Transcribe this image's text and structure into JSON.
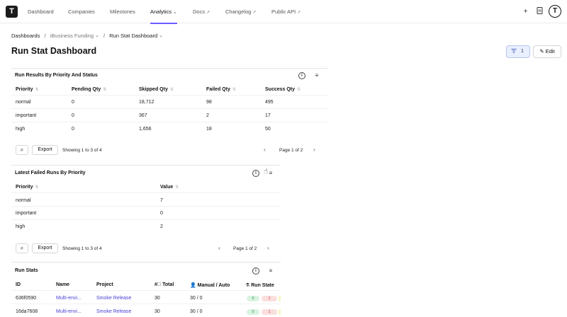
{
  "app": {
    "logo_letter": "T"
  },
  "nav": {
    "items": [
      {
        "label": "Dashboard"
      },
      {
        "label": "Companies"
      },
      {
        "label": "Milestones"
      },
      {
        "label": "Analytics"
      },
      {
        "label": "Docs"
      },
      {
        "label": "Changelog"
      },
      {
        "label": "Public API"
      }
    ],
    "active": "Analytics",
    "avatar_letter": "T"
  },
  "breadcrumb": {
    "items": [
      "Dashboards",
      "iBusiness Funding",
      "Run Stat Dashboard"
    ],
    "separator": "/"
  },
  "page": {
    "title": "Run Stat Dashboard"
  },
  "toolbar": {
    "filter_count": "1",
    "edit_label": "Edit"
  },
  "panel1": {
    "title": "Run Results By Priority And Status",
    "columns": [
      "Priority",
      "Pending Qty",
      "Skipped Qty",
      "Failed Qty",
      "Success Qty"
    ],
    "rows": [
      [
        "normal",
        "0",
        "18,712",
        "98",
        "495"
      ],
      [
        "important",
        "0",
        "367",
        "2",
        "17"
      ],
      [
        "high",
        "0",
        "1,656",
        "18",
        "50"
      ]
    ],
    "export_label": "Export",
    "showing": "Showing 1 to 3 of 4",
    "page": "Page 1 of 2"
  },
  "panel2": {
    "title": "Latest Failed Runs By Priority",
    "columns": [
      "Priority",
      "Value"
    ],
    "rows": [
      [
        "normal",
        "7"
      ],
      [
        "important",
        "0"
      ],
      [
        "high",
        "2"
      ]
    ],
    "export_label": "Export",
    "showing": "Showing 1 to 3 of 4",
    "page": "Page 1 of 2"
  },
  "panel3": {
    "title": "Run Stats",
    "columns": [
      "ID",
      "Name",
      "Project",
      "Total",
      "Manual / Auto",
      "Run State"
    ],
    "rows": [
      {
        "id": "636f0590",
        "name": "Multi-envi...",
        "project": "Smoke Release",
        "total": "30",
        "manual_auto": "30 / 0",
        "state_a": "0",
        "state_b": "1"
      },
      {
        "id": "16da7608",
        "name": "Multi-envi...",
        "project": "Smoke Release",
        "total": "30",
        "manual_auto": "30 / 0",
        "state_a": "0",
        "state_b": "1"
      }
    ]
  },
  "colors": {
    "accent": "#6b5cff",
    "link": "#4a3fd6",
    "filter_bg": "#e9efff",
    "state_green": "#d9f3e0",
    "state_red": "#fbdede",
    "state_yellow": "#fbf3c6"
  }
}
